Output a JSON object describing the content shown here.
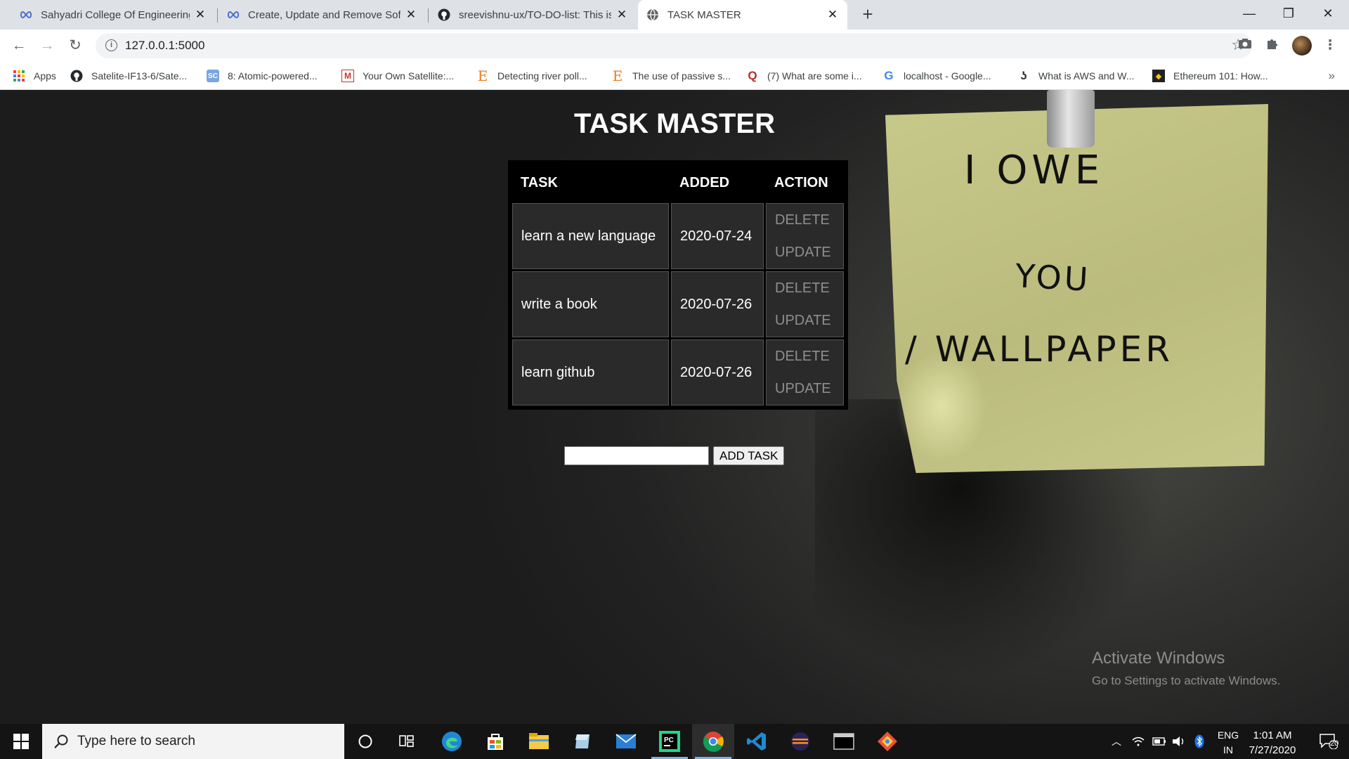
{
  "browser": {
    "tabs": [
      {
        "title": "Sahyadri College Of Engineering",
        "icon": "infinity-icon"
      },
      {
        "title": "Create, Update and Remove Soft",
        "icon": "infinity-icon"
      },
      {
        "title": "sreevishnu-ux/TO-DO-list: This is",
        "icon": "github-icon"
      },
      {
        "title": "TASK MASTER",
        "icon": "globe-icon",
        "active": true
      }
    ],
    "url": "127.0.0.1:5000",
    "bookmarks": [
      {
        "label": "Apps",
        "icon": "apps-grid-icon"
      },
      {
        "label": "Satelite-IF13-6/Sate...",
        "icon": "github-icon"
      },
      {
        "label": "8: Atomic-powered...",
        "icon": "sc-icon"
      },
      {
        "label": "Your Own Satellite:...",
        "icon": "m-icon"
      },
      {
        "label": "Detecting river poll...",
        "icon": "e-icon"
      },
      {
        "label": "The use of passive s...",
        "icon": "e-icon"
      },
      {
        "label": "(7) What are some i...",
        "icon": "quora-icon"
      },
      {
        "label": "localhost - Google...",
        "icon": "google-icon"
      },
      {
        "label": "What is AWS and W...",
        "icon": "j-icon"
      },
      {
        "label": "Ethereum 101: How...",
        "icon": "ethereum-icon"
      }
    ]
  },
  "app": {
    "title": "TASK MASTER",
    "columns": [
      "TASK",
      "ADDED",
      "ACTION"
    ],
    "rows": [
      {
        "task": "learn a new language",
        "added": "2020-07-24",
        "delete": "DELETE",
        "update": "UPDATE"
      },
      {
        "task": "write a book",
        "added": "2020-07-26",
        "delete": "DELETE",
        "update": "UPDATE"
      },
      {
        "task": "learn github",
        "added": "2020-07-26",
        "delete": "DELETE",
        "update": "UPDATE"
      }
    ],
    "add_input_value": "",
    "add_button": "ADD TASK"
  },
  "wallpaper": {
    "note_lines": [
      "I OWE",
      "YOU",
      "/ WALLPAPER"
    ],
    "note_color": "#c0c283"
  },
  "watermark": {
    "line1": "Activate Windows",
    "line2": "Go to Settings to activate Windows."
  },
  "taskbar": {
    "search_placeholder": "Type here to search",
    "lang_line1": "ENG",
    "lang_line2": "IN",
    "time": "1:01 AM",
    "date": "7/27/2020",
    "notification_count": "20",
    "apps": [
      "cortana-icon",
      "task-view-icon",
      "edge-icon",
      "store-icon",
      "file-explorer-icon",
      "app-icon",
      "mail-icon",
      "pycharm-icon",
      "chrome-icon",
      "vscode-icon",
      "eclipse-icon",
      "terminal-icon",
      "git-icon"
    ]
  }
}
